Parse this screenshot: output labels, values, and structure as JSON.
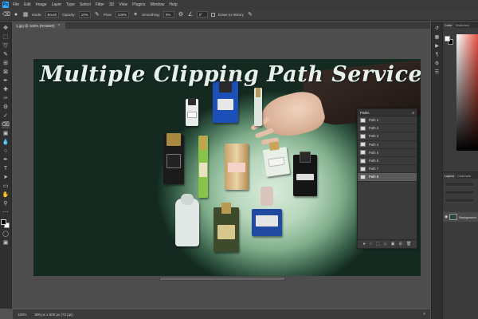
{
  "app": {
    "logo_text": "Ps"
  },
  "menu": [
    "File",
    "Edit",
    "Image",
    "Layer",
    "Type",
    "Select",
    "Filter",
    "3D",
    "View",
    "Plugins",
    "Window",
    "Help"
  ],
  "options_bar": {
    "mode_label": "Mode:",
    "mode_value": "Brush",
    "opacity_label": "Opacity:",
    "opacity_value": "10%",
    "flow_label": "Flow:",
    "flow_value": "100%",
    "smoothing_label": "Smoothing:",
    "smoothing_value": "0%",
    "angle_value": "0°",
    "erase_history_label": "Erase to History"
  },
  "document": {
    "tab_title": "1.jpg @ 100% (RGB/8#)",
    "close_glyph": "×"
  },
  "artwork": {
    "title": "Multiple Clipping Path Service"
  },
  "paths_panel": {
    "title": "Paths",
    "menu_glyph": "≡",
    "items": [
      {
        "label": "Path 1",
        "selected": false
      },
      {
        "label": "Path 2",
        "selected": false
      },
      {
        "label": "Path 3",
        "selected": false
      },
      {
        "label": "Path 4",
        "selected": false
      },
      {
        "label": "Path 5",
        "selected": false
      },
      {
        "label": "Path 6",
        "selected": false
      },
      {
        "label": "Path 7",
        "selected": false
      },
      {
        "label": "Path 8",
        "selected": true
      }
    ]
  },
  "status_bar": {
    "zoom": "100%",
    "dimensions": "900 px x 600 px (72 ppi)",
    "arrow": ">"
  },
  "right_panel": {
    "color_tabs": [
      "Color",
      "Swatches"
    ],
    "layer_tabs": [
      "Layers",
      "Channels"
    ],
    "layer_name": "Background"
  },
  "colors": {
    "accent": "#31a8ff",
    "panel": "#3b3b3b",
    "canvas_bg": "#4d4d4d"
  }
}
